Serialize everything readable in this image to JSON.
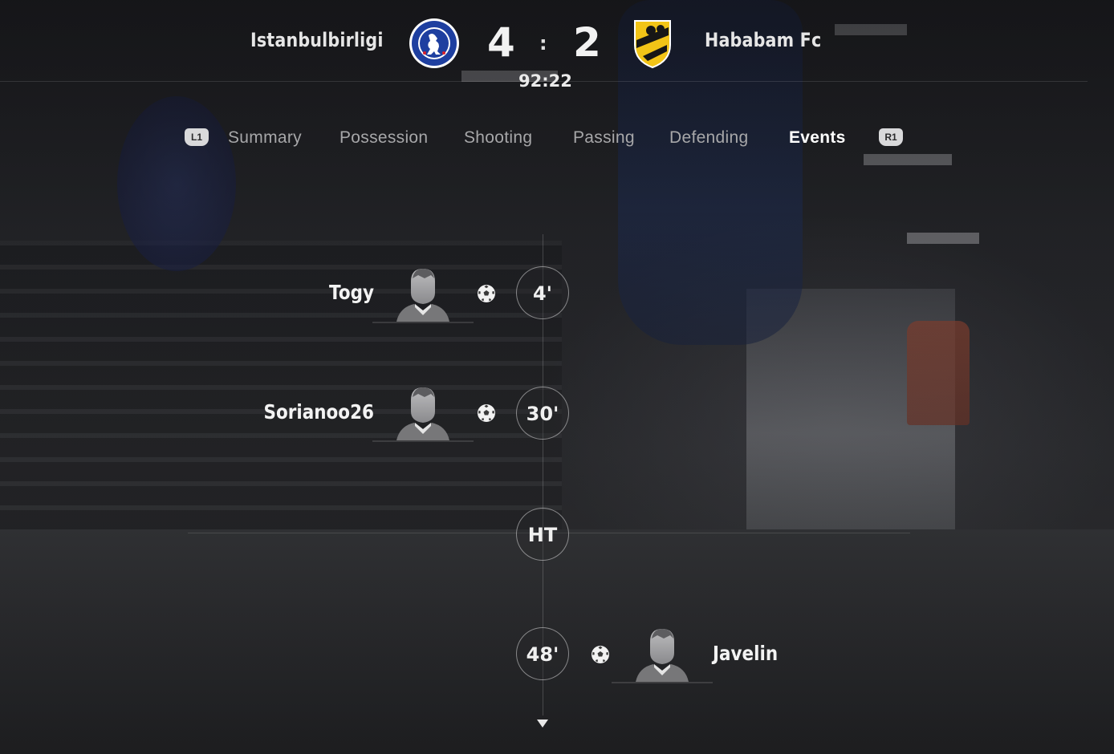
{
  "match": {
    "home_team": "Istanbulbirligi",
    "away_team": "Hababam Fc",
    "home_score": "4",
    "away_score": "2",
    "score_separator": ":",
    "clock": "92:22",
    "home_crest_icon": "chelsea-crest",
    "away_crest_icon": "yellow-black-shield-crest"
  },
  "tabs": {
    "left_bumper": "L1",
    "right_bumper": "R1",
    "items": [
      {
        "label": "Summary",
        "active": false
      },
      {
        "label": "Possession",
        "active": false
      },
      {
        "label": "Shooting",
        "active": false
      },
      {
        "label": "Passing",
        "active": false
      },
      {
        "label": "Defending",
        "active": false
      },
      {
        "label": "Events",
        "active": true
      }
    ]
  },
  "events": [
    {
      "minute": "4'",
      "player": "Togy",
      "side": "home",
      "type": "goal",
      "icon": "football-icon"
    },
    {
      "minute": "30'",
      "player": "Sorianoo26",
      "side": "home",
      "type": "goal",
      "icon": "football-icon"
    },
    {
      "minute": "HT",
      "player": "",
      "side": "none",
      "type": "half-time"
    },
    {
      "minute": "48'",
      "player": "Javelin",
      "side": "away",
      "type": "goal",
      "icon": "football-icon"
    }
  ],
  "colors": {
    "active_tab": "#ffffff",
    "inactive_tab": "#a7a7a9",
    "home_crest": "#1e3fa0",
    "away_crest": "#f2c417"
  }
}
